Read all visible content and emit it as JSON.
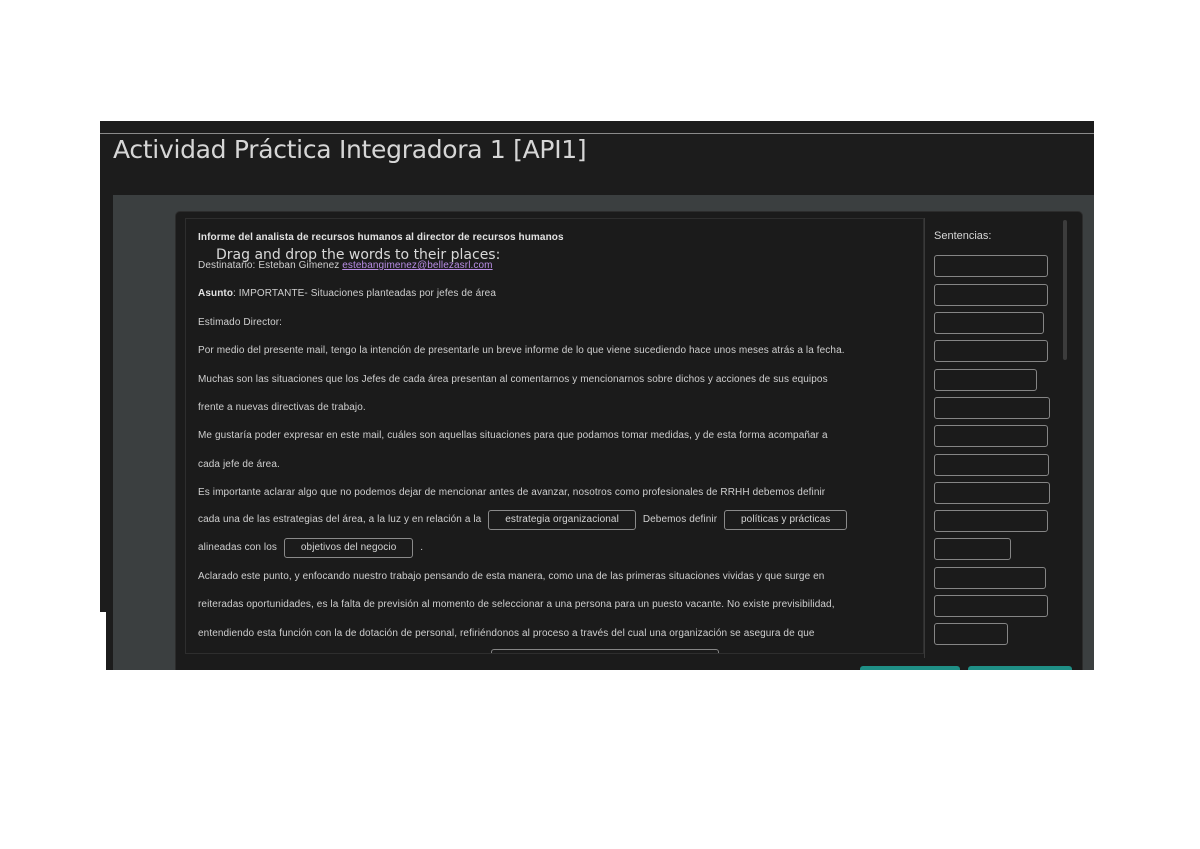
{
  "window": {
    "title": "Actividad Práctica Integradora 1 [API1]"
  },
  "activity": {
    "instruction": "Drag and drop the words to their places:",
    "email": {
      "heading": "Informe del analista de recursos humanos al director de recursos humanos",
      "recipient_label": "Destinatario:",
      "recipient_name": "Esteban Gimenez",
      "recipient_email": "estebangimenez@bellezasrl.com",
      "subject_label": "Asunto",
      "subject_text": ": IMPORTANTE- Situaciones planteadas por jefes de área",
      "greeting": "Estimado Director:",
      "p1": "Por medio del presente mail, tengo la intención de presentarle un breve informe de lo que viene sucediendo hace unos meses atrás a la fecha.",
      "p2a": "Muchas son las situaciones que los Jefes de cada área presentan al comentarnos y mencionarnos sobre dichos y acciones de sus equipos",
      "p2b": "frente a nuevas directivas de trabajo.",
      "p3a": "Me gustaría poder expresar en este mail, cuáles son aquellas situaciones para que podamos tomar medidas, y de esta forma acompañar a",
      "p3b": "cada jefe de área.",
      "p4a": "Es importante aclarar algo que no podemos dejar de mencionar antes de avanzar, nosotros como profesionales de RRHH debemos definir",
      "p4b_pre": "cada una de las estrategias del área, a la luz y en relación a la",
      "p4b_word1": "estrategia organizacional",
      "p4b_mid": "Debemos definir",
      "p4b_word2": "políticas y prácticas",
      "p4c_pre": "alineadas con los",
      "p4c_word3": "objetivos del negocio",
      "p4c_post": ".",
      "p5a": "Aclarado este punto, y enfocando nuestro trabajo pensando de esta manera, como una de las primeras situaciones vividas y que surge en",
      "p5b": "reiteradas oportunidades, es la falta de previsión al momento de seleccionar a una persona para un puesto vacante. No existe previsibilidad,",
      "p5c": "entendiendo esta función con la de dotación de personal, refiriéndonos al proceso a través del cual una organización se asegura de que"
    },
    "sentences": {
      "label": "Sentencias:",
      "slot_count": 14
    }
  },
  "colors": {
    "frame_bg": "#1c1c1c",
    "content_bg": "#3b3f40",
    "panel_bg": "#1b1b1b",
    "link": "#b98ee6",
    "accent_button": "#1f8f86"
  }
}
